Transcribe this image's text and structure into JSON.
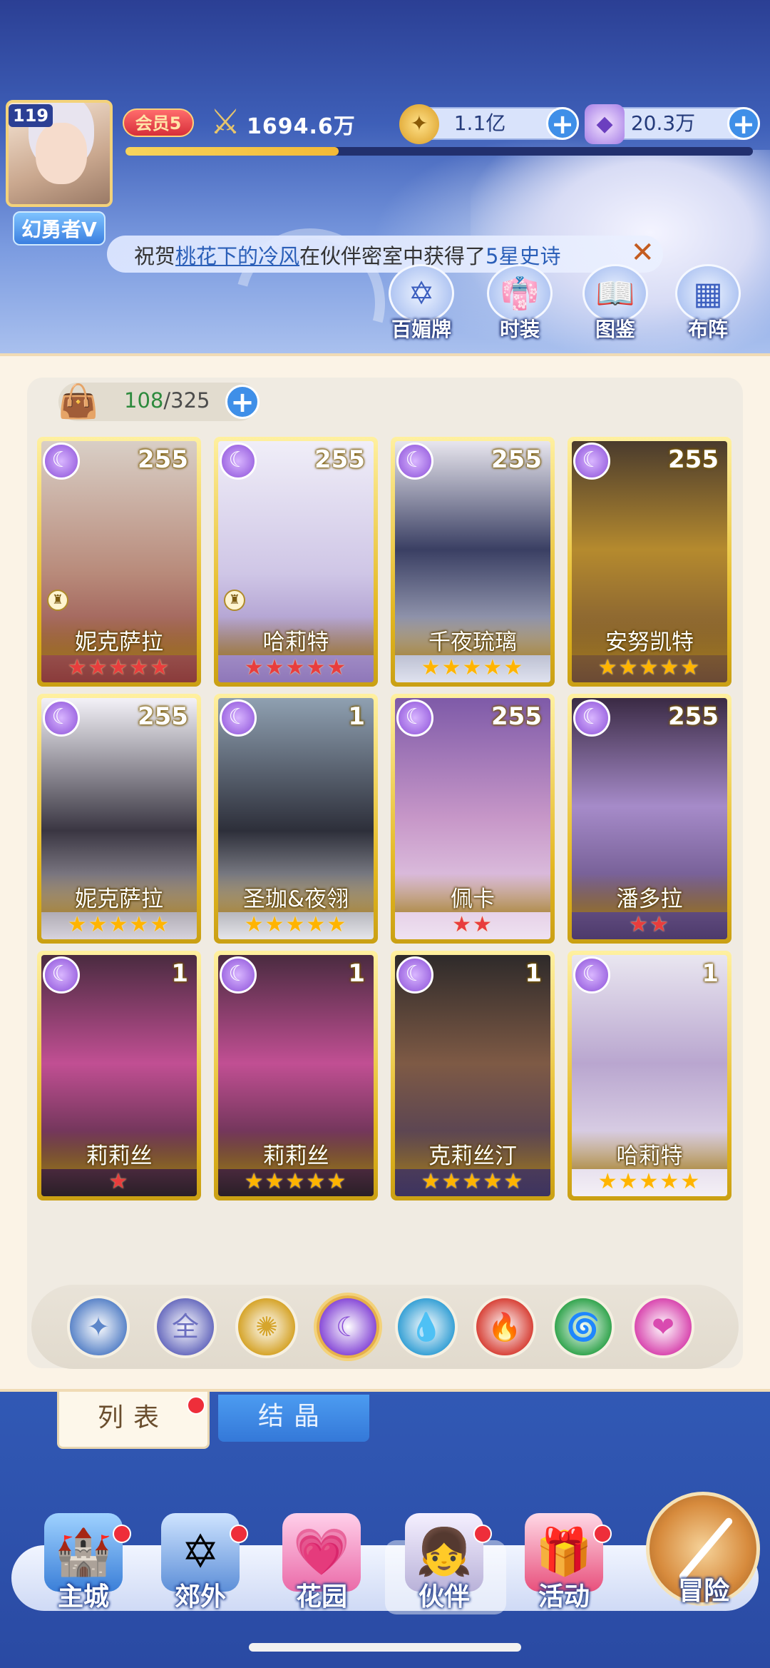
{
  "player": {
    "level": "119",
    "title": "幻勇者V",
    "vip": "会员5",
    "power": "1694.6万",
    "exp_fraction": 0.34
  },
  "resources": {
    "gold": "1.1亿",
    "gems": "20.3万"
  },
  "ticker": {
    "prefix": "祝贺",
    "player": "桃花下的冷风",
    "middle": "在伙伴密室中获得了",
    "reward": "5星史诗"
  },
  "header_buttons": [
    {
      "label": "百媚牌",
      "icon": "card-deck-icon"
    },
    {
      "label": "时装",
      "icon": "outfit-icon"
    },
    {
      "label": "图鉴",
      "icon": "book-icon"
    },
    {
      "label": "布阵",
      "icon": "formation-grid-icon"
    }
  ],
  "capacity": {
    "current": "108",
    "total": "/325"
  },
  "cards": [
    {
      "name": "妮克萨拉",
      "level": "255",
      "stars": 5,
      "star_color": "red",
      "element": "moon"
    },
    {
      "name": "哈莉特",
      "level": "255",
      "stars": 5,
      "star_color": "red",
      "element": "moon"
    },
    {
      "name": "千夜琉璃",
      "level": "255",
      "stars": 5,
      "star_color": "gold",
      "element": "moon"
    },
    {
      "name": "安努凯特",
      "level": "255",
      "stars": 5,
      "star_color": "gold",
      "element": "moon"
    },
    {
      "name": "妮克萨拉",
      "level": "255",
      "stars": 5,
      "star_color": "gold",
      "element": "moon"
    },
    {
      "name": "圣珈&夜翎",
      "level": "1",
      "stars": 5,
      "star_color": "gold",
      "element": "moon"
    },
    {
      "name": "佩卡",
      "level": "255",
      "stars": 2,
      "star_color": "red",
      "element": "moon"
    },
    {
      "name": "潘多拉",
      "level": "255",
      "stars": 2,
      "star_color": "red",
      "element": "moon"
    },
    {
      "name": "莉莉丝",
      "level": "1",
      "stars": 1,
      "star_color": "red",
      "element": "moon"
    },
    {
      "name": "莉莉丝",
      "level": "1",
      "stars": 5,
      "star_color": "gold",
      "element": "moon"
    },
    {
      "name": "克莉丝汀",
      "level": "1",
      "stars": 5,
      "star_color": "gold",
      "element": "moon"
    },
    {
      "name": "哈莉特",
      "level": "1",
      "stars": 5,
      "star_color": "gold",
      "element": "moon"
    }
  ],
  "filters": [
    {
      "name": "filter-light-icon",
      "glyph": "✦",
      "color": "#5d86c9"
    },
    {
      "name": "filter-all-icon",
      "glyph": "全",
      "color": "#6c6fc0"
    },
    {
      "name": "filter-sun-icon",
      "glyph": "✺",
      "color": "#d6a52c"
    },
    {
      "name": "filter-moon-icon",
      "glyph": "☾",
      "color": "#8a4ed8"
    },
    {
      "name": "filter-water-icon",
      "glyph": "💧",
      "color": "#3aa2d6"
    },
    {
      "name": "filter-fire-icon",
      "glyph": "🔥",
      "color": "#d8453b"
    },
    {
      "name": "filter-wind-icon",
      "glyph": "🌀",
      "color": "#36a651"
    },
    {
      "name": "filter-heart-icon",
      "glyph": "❤",
      "color": "#d94ab0"
    }
  ],
  "tabs": {
    "list": "列表",
    "crystal": "结晶"
  },
  "nav": [
    {
      "label": "主城",
      "icon": "castle-icon",
      "glyph": "🏰",
      "dot": true
    },
    {
      "label": "郊外",
      "icon": "portal-icon",
      "glyph": "✡",
      "dot": true
    },
    {
      "label": "花园",
      "icon": "heart-icon",
      "glyph": "💗",
      "dot": false
    },
    {
      "label": "伙伴",
      "icon": "partner-icon",
      "glyph": "👧",
      "dot": true
    },
    {
      "label": "活动",
      "icon": "gift-icon",
      "glyph": "🎁",
      "dot": true
    },
    {
      "label": "冒险",
      "icon": "compass-icon",
      "glyph": "",
      "dot": false
    }
  ]
}
